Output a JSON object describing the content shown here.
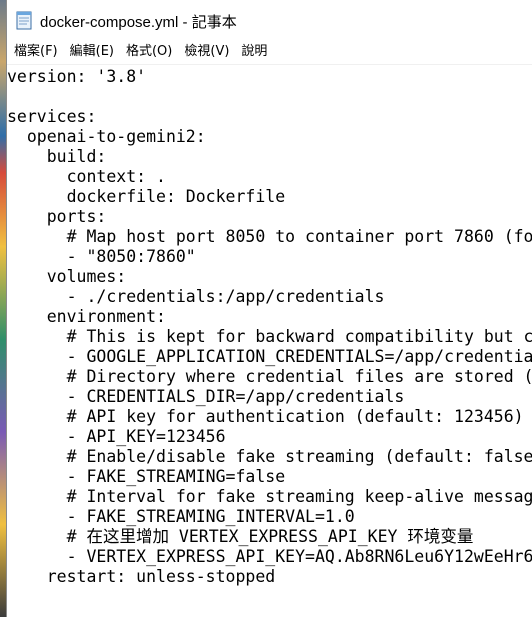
{
  "window": {
    "title": "docker-compose.yml - 記事本",
    "app_icon": "notepad-icon"
  },
  "menu": {
    "items": [
      "檔案(F)",
      "編輯(E)",
      "格式(O)",
      "檢視(V)",
      "說明"
    ]
  },
  "document": {
    "lines": [
      "version: '3.8'",
      "",
      "services:",
      "  openai-to-gemini2:",
      "    build:",
      "      context: .",
      "      dockerfile: Dockerfile",
      "    ports:",
      "      # Map host port 8050 to container port 7860 (fo",
      "      - \"8050:7860\"",
      "    volumes:",
      "      - ./credentials:/app/credentials",
      "    environment:",
      "      # This is kept for backward compatibility but c",
      "      - GOOGLE_APPLICATION_CREDENTIALS=/app/credentia",
      "      # Directory where credential files are stored (",
      "      - CREDENTIALS_DIR=/app/credentials",
      "      # API key for authentication (default: 123456)",
      "      - API_KEY=123456",
      "      # Enable/disable fake streaming (default: false",
      "      - FAKE_STREAMING=false",
      "      # Interval for fake streaming keep-alive messag",
      "      - FAKE_STREAMING_INTERVAL=1.0",
      "      # 在这里增加 VERTEX_EXPRESS_API_KEY 环境变量",
      "      - VERTEX_EXPRESS_API_KEY=AQ.Ab8RN6Leu6Y12wEeHr6",
      "    restart: unless-stopped"
    ]
  }
}
